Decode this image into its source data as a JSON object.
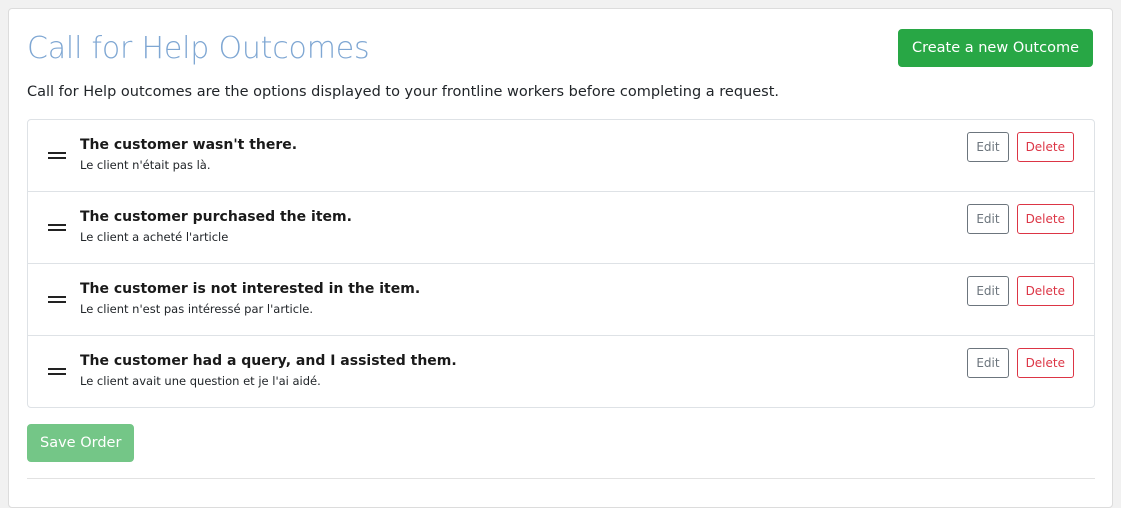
{
  "page": {
    "title": "Call for Help Outcomes",
    "description": "Call for Help outcomes are the options displayed to your frontline workers before completing a request."
  },
  "toolbar": {
    "create_label": "Create a new Outcome",
    "save_label": "Save Order"
  },
  "outcomes": [
    {
      "label": "The customer wasn't there.",
      "translation": "Le client n'était pas là.",
      "edit_label": "Edit",
      "delete_label": "Delete"
    },
    {
      "label": "The customer purchased the item.",
      "translation": "Le client a acheté l'article",
      "edit_label": "Edit",
      "delete_label": "Delete"
    },
    {
      "label": "The customer is not interested in the item.",
      "translation": "Le client n'est pas intéressé par l'article.",
      "edit_label": "Edit",
      "delete_label": "Delete"
    },
    {
      "label": "The customer had a query, and I assisted them.",
      "translation": "Le client avait une question et je l'ai aidé.",
      "edit_label": "Edit",
      "delete_label": "Delete"
    }
  ],
  "colors": {
    "title": "#7fa7d3",
    "success": "#28a745",
    "success_disabled": "#74c687",
    "danger": "#dc3545",
    "secondary": "#6c757d"
  },
  "icons": {
    "drag_handle": "drag-handle-icon"
  }
}
